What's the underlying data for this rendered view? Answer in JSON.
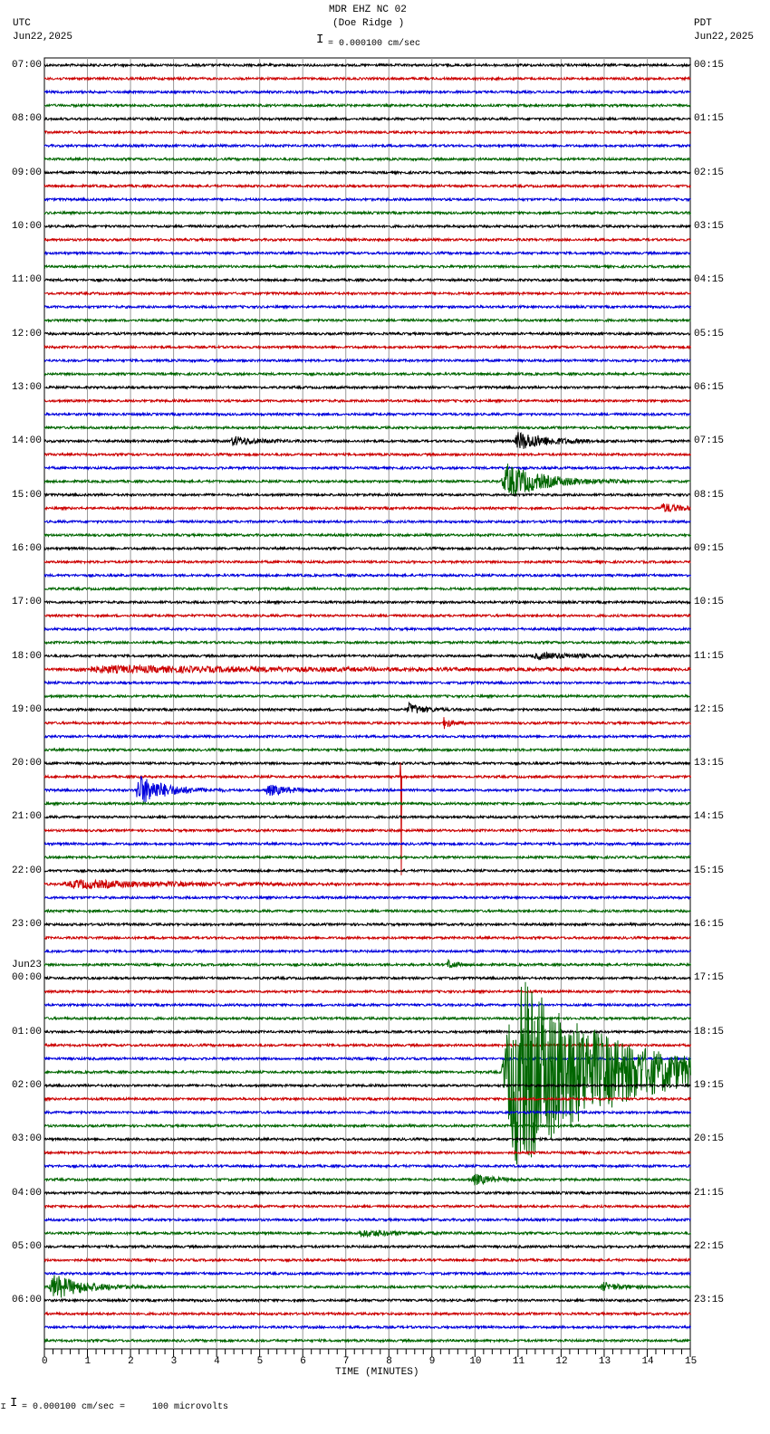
{
  "header": {
    "title": "MDR EHZ NC 02",
    "subtitle": "(Doe Ridge )",
    "left_tz": "UTC",
    "left_date": "Jun22,2025",
    "right_tz": "PDT",
    "right_date": "Jun22,2025",
    "scale": "= 0.000100 cm/sec"
  },
  "footer": {
    "scale": "= 0.000100 cm/sec =     100 microvolts",
    "mark": "⌶"
  },
  "chart_data": {
    "type": "line",
    "title": "MDR EHZ NC 02 (Doe Ridge )",
    "xlabel": "TIME (MINUTES)",
    "xlim": [
      0,
      15
    ],
    "x_ticks": [
      "0",
      "1",
      "2",
      "3",
      "4",
      "5",
      "6",
      "7",
      "8",
      "9",
      "10",
      "11",
      "12",
      "13",
      "14",
      "15"
    ],
    "minutes_per_trace": 15,
    "trace_count": 96,
    "trace_colors": [
      "#000000",
      "#cc0000",
      "#0000dd",
      "#006600"
    ],
    "left_labels": [
      "07:00",
      "08:00",
      "09:00",
      "10:00",
      "11:00",
      "12:00",
      "13:00",
      "14:00",
      "15:00",
      "16:00",
      "17:00",
      "18:00",
      "19:00",
      "20:00",
      "21:00",
      "22:00",
      "23:00",
      "00:00",
      "01:00",
      "02:00",
      "03:00",
      "04:00",
      "05:00",
      "06:00"
    ],
    "date_change_label": "Jun23",
    "right_labels": [
      "00:15",
      "01:15",
      "02:15",
      "03:15",
      "04:15",
      "05:15",
      "06:15",
      "07:15",
      "08:15",
      "09:15",
      "10:15",
      "11:15",
      "12:15",
      "13:15",
      "14:15",
      "15:15",
      "16:15",
      "17:15",
      "18:15",
      "19:15",
      "20:15",
      "21:15",
      "22:15",
      "23:15"
    ],
    "events": [
      {
        "trace": 28,
        "minute": 4.3,
        "amp": 6,
        "dur": 0.6
      },
      {
        "trace": 28,
        "minute": 10.9,
        "amp": 12,
        "dur": 0.8
      },
      {
        "trace": 31,
        "minute": 10.6,
        "amp": 22,
        "dur": 1.0
      },
      {
        "trace": 33,
        "minute": 14.3,
        "amp": 6,
        "dur": 0.5
      },
      {
        "trace": 44,
        "minute": 11.3,
        "amp": 4,
        "dur": 1.2
      },
      {
        "trace": 45,
        "minute": 0.5,
        "amp": 4,
        "dur": 6.5
      },
      {
        "trace": 48,
        "minute": 8.4,
        "amp": 8,
        "dur": 0.4
      },
      {
        "trace": 49,
        "minute": 9.25,
        "amp": 7,
        "dur": 0.2
      },
      {
        "trace": 54,
        "minute": 2.1,
        "amp": 20,
        "dur": 0.7
      },
      {
        "trace": 54,
        "minute": 5.1,
        "amp": 7,
        "dur": 0.6
      },
      {
        "trace": 53,
        "minute": 8.25,
        "amp": 110,
        "dur": 0.08
      },
      {
        "trace": 61,
        "minute": 0.4,
        "amp": 5,
        "dur": 2.6
      },
      {
        "trace": 67,
        "minute": 9.35,
        "amp": 6,
        "dur": 0.2
      },
      {
        "trace": 75,
        "minute": 10.6,
        "amp": 130,
        "dur": 2.5
      },
      {
        "trace": 83,
        "minute": 9.9,
        "amp": 7,
        "dur": 0.5
      },
      {
        "trace": 87,
        "minute": 7.2,
        "amp": 4,
        "dur": 1.0
      },
      {
        "trace": 91,
        "minute": 0.1,
        "amp": 16,
        "dur": 0.8
      },
      {
        "trace": 91,
        "minute": 12.9,
        "amp": 5,
        "dur": 0.5
      }
    ]
  }
}
